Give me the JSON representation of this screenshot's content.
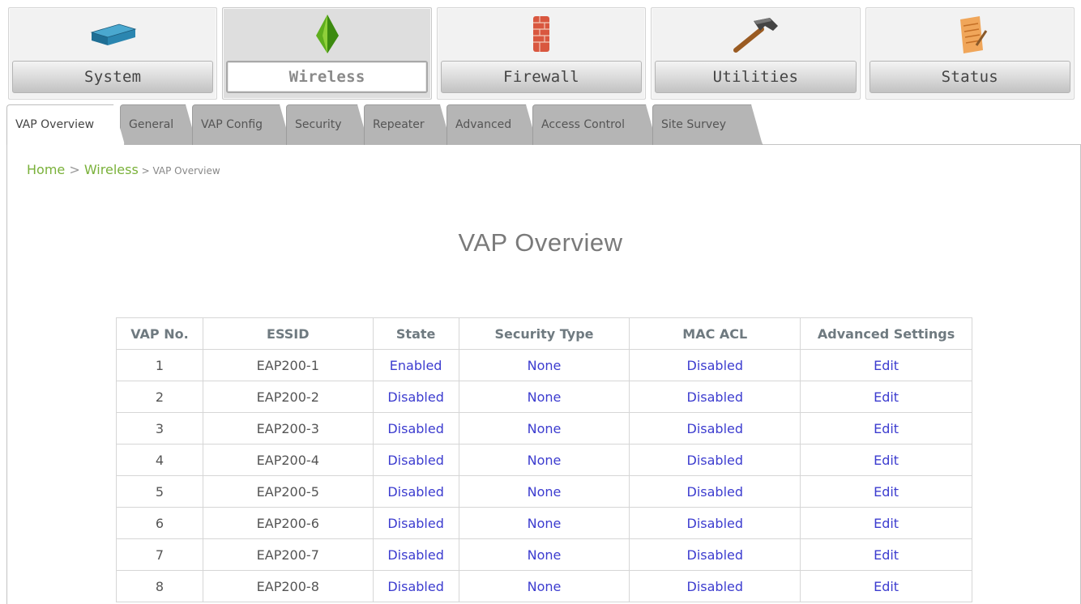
{
  "topnav": [
    {
      "label": "System",
      "icon": "router-icon",
      "active": false
    },
    {
      "label": "Wireless",
      "icon": "wireless-pyramid-icon",
      "active": true
    },
    {
      "label": "Firewall",
      "icon": "firewall-brick-icon",
      "active": false
    },
    {
      "label": "Utilities",
      "icon": "hammer-icon",
      "active": false
    },
    {
      "label": "Status",
      "icon": "notepad-icon",
      "active": false
    }
  ],
  "tabs": [
    {
      "label": "VAP Overview",
      "active": true
    },
    {
      "label": "General",
      "active": false
    },
    {
      "label": "VAP Config",
      "active": false
    },
    {
      "label": "Security",
      "active": false
    },
    {
      "label": "Repeater",
      "active": false
    },
    {
      "label": "Advanced",
      "active": false
    },
    {
      "label": "Access Control",
      "active": false
    },
    {
      "label": "Site Survey",
      "active": false
    }
  ],
  "breadcrumb": {
    "home": "Home",
    "sep1": " > ",
    "section": "Wireless",
    "sep2": " > ",
    "current": "VAP Overview"
  },
  "page_title": "VAP Overview",
  "table": {
    "headers": [
      "VAP No.",
      "ESSID",
      "State",
      "Security Type",
      "MAC ACL",
      "Advanced Settings"
    ],
    "rows": [
      [
        "1",
        "EAP200-1",
        "Enabled",
        "None",
        "Disabled",
        "Edit"
      ],
      [
        "2",
        "EAP200-2",
        "Disabled",
        "None",
        "Disabled",
        "Edit"
      ],
      [
        "3",
        "EAP200-3",
        "Disabled",
        "None",
        "Disabled",
        "Edit"
      ],
      [
        "4",
        "EAP200-4",
        "Disabled",
        "None",
        "Disabled",
        "Edit"
      ],
      [
        "5",
        "EAP200-5",
        "Disabled",
        "None",
        "Disabled",
        "Edit"
      ],
      [
        "6",
        "EAP200-6",
        "Disabled",
        "None",
        "Disabled",
        "Edit"
      ],
      [
        "7",
        "EAP200-7",
        "Disabled",
        "None",
        "Disabled",
        "Edit"
      ],
      [
        "8",
        "EAP200-8",
        "Disabled",
        "None",
        "Disabled",
        "Edit"
      ]
    ]
  },
  "colors": {
    "link": "#3c3ccf",
    "breadcrumb_link": "#7ab13a",
    "header_text": "#6f7a80"
  }
}
